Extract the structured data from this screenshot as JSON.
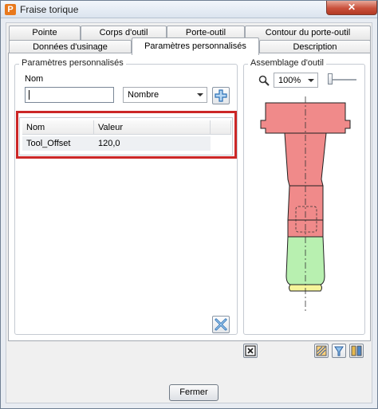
{
  "window": {
    "title": "Fraise torique",
    "app_icon_glyph": "P",
    "close_glyph": "✕"
  },
  "tabs": {
    "row1": [
      "Pointe",
      "Corps d'outil",
      "Porte-outil",
      "Contour du porte-outil"
    ],
    "row2": [
      "Données d'usinage",
      "Paramètres personnalisés",
      "Description"
    ],
    "active": "Paramètres personnalisés"
  },
  "custom_params": {
    "group_title": "Paramètres personnalisés",
    "name_label": "Nom",
    "name_value": "",
    "type_value": "Nombre",
    "table": {
      "headers": [
        "Nom",
        "Valeur"
      ],
      "rows": [
        {
          "name": "Tool_Offset",
          "value": "120,0"
        }
      ]
    }
  },
  "assembly": {
    "group_title": "Assemblage d'outil",
    "zoom_value": "100%",
    "colors": {
      "holder": "#f08a8a",
      "body": "#b8f0b0",
      "tip": "#f6f59a",
      "outline": "#202020"
    }
  },
  "footer": {
    "close_label": "Fermer"
  },
  "icons": {
    "add": "plus-icon",
    "delete": "delete-params-icon",
    "zoom": "magnifier-icon",
    "fit": "fit-view-icon",
    "view1": "view-holder-icon",
    "view2": "view-tool-icon",
    "view3": "view-assembly-icon"
  }
}
